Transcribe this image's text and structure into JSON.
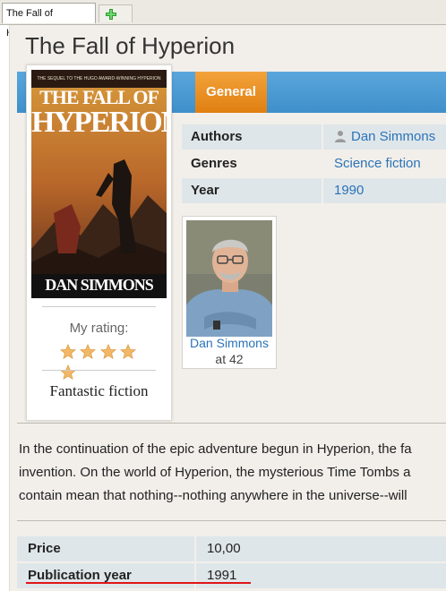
{
  "tabs": {
    "active_label": "The Fall of Hyperion",
    "add_icon": "plus-icon"
  },
  "book": {
    "title": "The Fall of Hyperion",
    "cover": {
      "tagline": "THE SEQUEL TO THE HUGO AWARD-WINNING HYPERION",
      "title_line1": "THE FALL OF",
      "title_line2": "HYPERION",
      "author": "DAN SIMMONS"
    },
    "rating_label": "My rating:",
    "rating": 5,
    "rating_max": 5,
    "verdict": "Fantastic fiction"
  },
  "section_tab": "General",
  "info": {
    "authors_label": "Authors",
    "authors_value": "Dan Simmons",
    "genres_label": "Genres",
    "genres_value": "Science fiction",
    "year_label": "Year",
    "year_value": "1990"
  },
  "author_card": {
    "name": "Dan Simmons",
    "age": "at 42"
  },
  "description": [
    "In the continuation of the epic adventure begun in Hyperion, the fa",
    "invention. On the world of Hyperion, the mysterious Time Tombs a",
    "contain mean that nothing--nothing anywhere in the universe--will"
  ],
  "details": {
    "price_label": "Price",
    "price_value": "10,00",
    "pub_label": "Publication year",
    "pub_value": "1991"
  },
  "colors": {
    "accent_blue": "#4796d3",
    "accent_orange": "#e8901f",
    "link": "#2a73b8",
    "highlight_underline": "#e0151a"
  }
}
